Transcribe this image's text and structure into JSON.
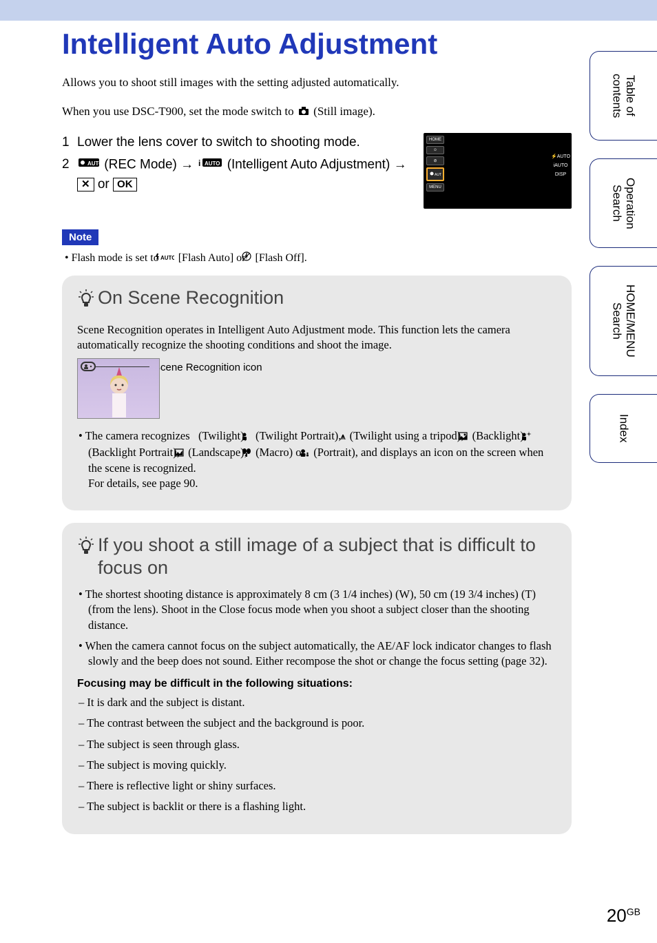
{
  "title": "Intelligent Auto Adjustment",
  "intro": {
    "p1": "Allows you to shoot still images with the setting adjusted automatically.",
    "p2_pre": "When you use DSC-T900, set the mode switch to ",
    "p2_post": " (Still image)."
  },
  "steps": {
    "s1_num": "1",
    "s1_text": "Lower the lens cover to switch to shooting mode.",
    "s2_num": "2",
    "s2_pre": " (REC Mode) → ",
    "s2_mid": " (Intelligent Auto Adjustment) → ",
    "s2_or": " or ",
    "close_x": "✕",
    "ok": "OK"
  },
  "camera_preview": {
    "home": "HOME",
    "menu": "MENU",
    "flash_auto": "⚡AUTO",
    "iauto": "iAUTO",
    "disp": "DISP"
  },
  "note": {
    "label": "Note",
    "bullet_pre": "•  Flash mode is set to ",
    "bullet_mid1": " [Flash Auto] or ",
    "bullet_mid2": " [Flash Off]."
  },
  "tip1": {
    "title": "On Scene Recognition",
    "p1": "Scene Recognition operates in Intelligent Auto Adjustment mode. This function lets the camera automatically recognize the shooting conditions and shoot the image.",
    "scene_label": "Scene Recognition icon",
    "bullet_pre": "•  The camera recognizes ",
    "twilight": " (Twilight), ",
    "twilight_portrait": " (Twilight Portrait), ",
    "twilight_tripod": " (Twilight using a tripod), ",
    "backlight": " (Backlight), ",
    "backlight_portrait": " (Backlight Portrait), ",
    "landscape": " (Landscape), ",
    "macro": " (Macro) or ",
    "portrait": " (Portrait), and displays an icon on the screen when the scene is recognized.",
    "details": "For details, see page 90."
  },
  "tip2": {
    "title": "If you shoot a still image of a subject that is difficult to focus on",
    "b1": "•  The shortest shooting distance is approximately 8 cm (3 1/4 inches) (W), 50 cm (19 3/4 inches) (T) (from the lens). Shoot in the Close focus mode when you shoot a subject closer than the shooting distance.",
    "b2": "•  When the camera cannot focus on the subject automatically, the AE/AF lock indicator changes to flash slowly and the beep does not sound. Either recompose the shot or change the focus setting (page 32).",
    "focus_heading": "Focusing may be difficult in the following situations:",
    "d1": "–  It is dark and the subject is distant.",
    "d2": "–  The contrast between the subject and the background is poor.",
    "d3": "–  The subject is seen through glass.",
    "d4": "–  The subject is moving quickly.",
    "d5": "–  There is reflective light or shiny surfaces.",
    "d6": "–  The subject is backlit or there is a flashing light."
  },
  "side_tabs": {
    "toc": "Table of contents",
    "op": "Operation Search",
    "home": "HOME/MENU Search",
    "index": "Index"
  },
  "page": {
    "num": "20",
    "suffix": "GB"
  }
}
